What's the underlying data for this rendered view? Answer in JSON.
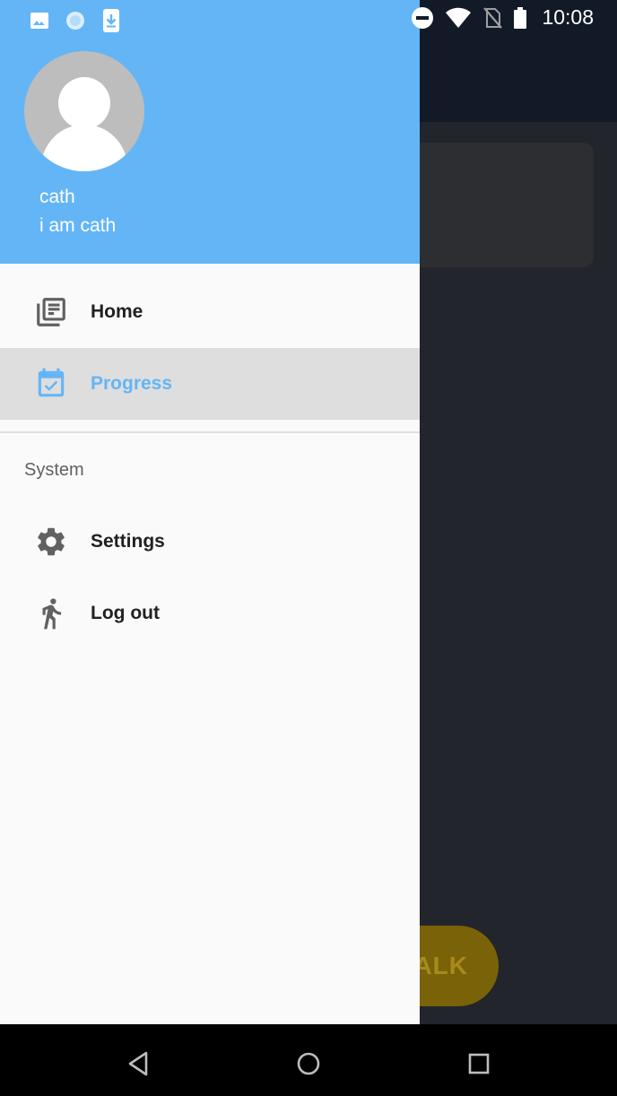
{
  "status_bar": {
    "time": "10:08",
    "left_icons": [
      "image-icon",
      "sync-circle-icon",
      "download-icon"
    ],
    "right_icons": [
      "do-not-disturb-icon",
      "wifi-icon",
      "no-sim-icon",
      "battery-icon"
    ]
  },
  "drawer": {
    "header": {
      "name": "cath",
      "email": "i am cath",
      "background_color": "#64b5f6"
    },
    "items": [
      {
        "label": "Home",
        "icon": "library-books-icon",
        "active": false
      },
      {
        "label": "Progress",
        "icon": "calendar-check-icon",
        "active": true
      }
    ],
    "section": {
      "title": "System",
      "items": [
        {
          "label": "Settings",
          "icon": "gear-icon"
        },
        {
          "label": "Log out",
          "icon": "walk-icon"
        }
      ]
    },
    "accent_color": "#64b5f6"
  },
  "background": {
    "fab_label": "ALK"
  },
  "nav_bar": {
    "buttons": [
      "back-icon",
      "home-icon",
      "recents-icon"
    ]
  }
}
